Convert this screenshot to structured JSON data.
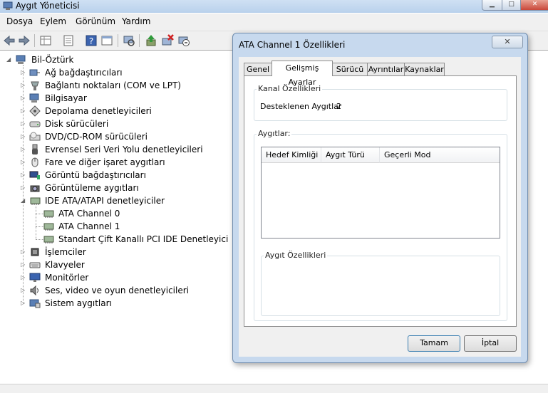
{
  "window": {
    "title": "Aygıt Yöneticisi"
  },
  "menu": [
    "Dosya",
    "Eylem",
    "Görünüm",
    "Yardım"
  ],
  "toolbar_icons": [
    "back-arrow-icon",
    "forward-arrow-icon",
    "properties-grid-icon",
    "list-view-icon",
    "help-icon",
    "panel-icon",
    "scan-hardware-icon",
    "update-driver-icon",
    "disable-device-icon",
    "uninstall-device-icon"
  ],
  "tree": {
    "root": "Bil-Öztürk",
    "items": [
      {
        "label": "Ağ bağdaştırıcıları",
        "icon": "network-adapter-icon"
      },
      {
        "label": "Bağlantı noktaları (COM ve LPT)",
        "icon": "port-icon"
      },
      {
        "label": "Bilgisayar",
        "icon": "computer-icon"
      },
      {
        "label": "Depolama denetleyicileri",
        "icon": "storage-controller-icon"
      },
      {
        "label": "Disk sürücüleri",
        "icon": "disk-drive-icon"
      },
      {
        "label": "DVD/CD-ROM sürücüleri",
        "icon": "dvd-drive-icon"
      },
      {
        "label": "Evrensel Seri Veri Yolu denetleyicileri",
        "icon": "usb-icon"
      },
      {
        "label": "Fare ve diğer işaret aygıtları",
        "icon": "mouse-icon"
      },
      {
        "label": "Görüntü bağdaştırıcıları",
        "icon": "display-adapter-icon"
      },
      {
        "label": "Görüntüleme aygıtları",
        "icon": "camera-icon"
      },
      {
        "label": "IDE ATA/ATAPI denetleyiciler",
        "icon": "ide-controller-icon"
      },
      {
        "label": "İşlemciler",
        "icon": "processor-icon"
      },
      {
        "label": "Klavyeler",
        "icon": "keyboard-icon"
      },
      {
        "label": "Monitörler",
        "icon": "monitor-icon"
      },
      {
        "label": "Ses, video ve oyun denetleyicileri",
        "icon": "sound-icon"
      },
      {
        "label": "Sistem aygıtları",
        "icon": "system-device-icon"
      }
    ],
    "ide_children": [
      "ATA Channel 0",
      "ATA Channel 1",
      "Standart Çift Kanallı PCI IDE Denetleyici"
    ]
  },
  "dialog": {
    "title": "ATA Channel 1 Özellikleri",
    "close": "✕",
    "tabs": [
      "Genel",
      "Gelişmiş Ayarlar",
      "Sürücü",
      "Ayrıntılar",
      "Kaynaklar"
    ],
    "active_tab": "Gelişmiş Ayarlar",
    "channel_group": "Kanal Özellikleri",
    "supported_label": "Desteklenen Aygıtlar",
    "supported_value": "2",
    "devices_group": "Aygıtlar:",
    "columns": [
      "Hedef Kimliği",
      "Aygıt Türü",
      "Geçerli Mod"
    ],
    "device_props_group": "Aygıt Özellikleri",
    "ok": "Tamam",
    "cancel": "İptal"
  },
  "colors": {
    "title_bar": "#b9d1ec",
    "dialog_frame": "#c7d9ee",
    "close_red": "#c9473a"
  }
}
